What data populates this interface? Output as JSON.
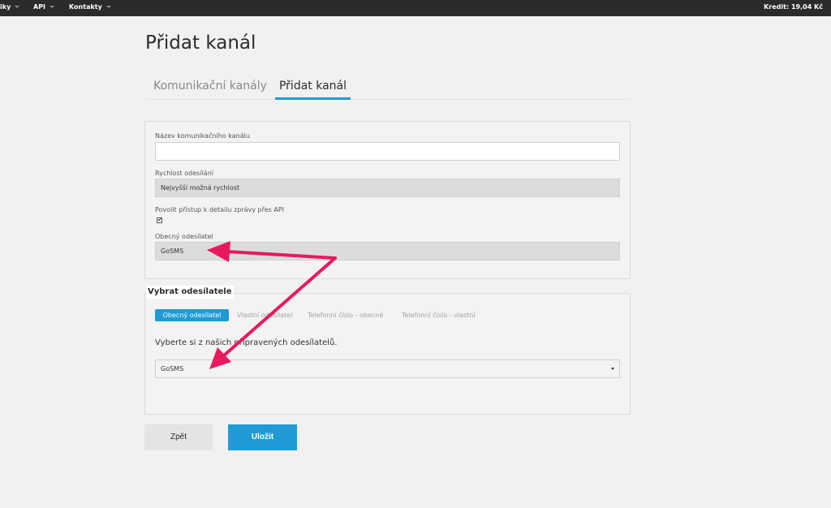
{
  "topbar": {
    "items": [
      {
        "label": "iky"
      },
      {
        "label": "API"
      },
      {
        "label": "Kontakty"
      }
    ],
    "credit": "Kredit: 19,04 Kč"
  },
  "page": {
    "title": "Přidat kanál"
  },
  "tabs": [
    {
      "label": "Komunikační kanály",
      "active": false
    },
    {
      "label": "Přidat kanál",
      "active": true
    }
  ],
  "form": {
    "channel_name": {
      "label": "Název komunikačního kanálu",
      "value": ""
    },
    "speed": {
      "label": "Rychlost odesílání",
      "value": "Nejvyšší možná rychlost"
    },
    "api_access": {
      "label": "Povolit přístup k detailu zprávy přes API",
      "checked": true,
      "mark": "✔"
    },
    "generic_sender": {
      "label": "Obecný odesílatel",
      "value": "GoSMS"
    }
  },
  "sender_section": {
    "legend": "Vybrat odesílatele",
    "options": [
      {
        "label": "Obecný odesílatel",
        "active": true
      },
      {
        "label": "Vlastní odesílatel",
        "active": false
      },
      {
        "label": "Telefonní číslo - obecné",
        "active": false
      },
      {
        "label": "Telefonní číslo - vlastní",
        "active": false
      }
    ],
    "intro": "Vyberte si z našich připravených odesílatelů.",
    "select_value": "GoSMS"
  },
  "buttons": {
    "back": "Zpět",
    "save": "Uložit"
  },
  "colors": {
    "topbar": "#2b2b2b",
    "accent": "#1f9ad6",
    "arrow": "#e8195c"
  }
}
